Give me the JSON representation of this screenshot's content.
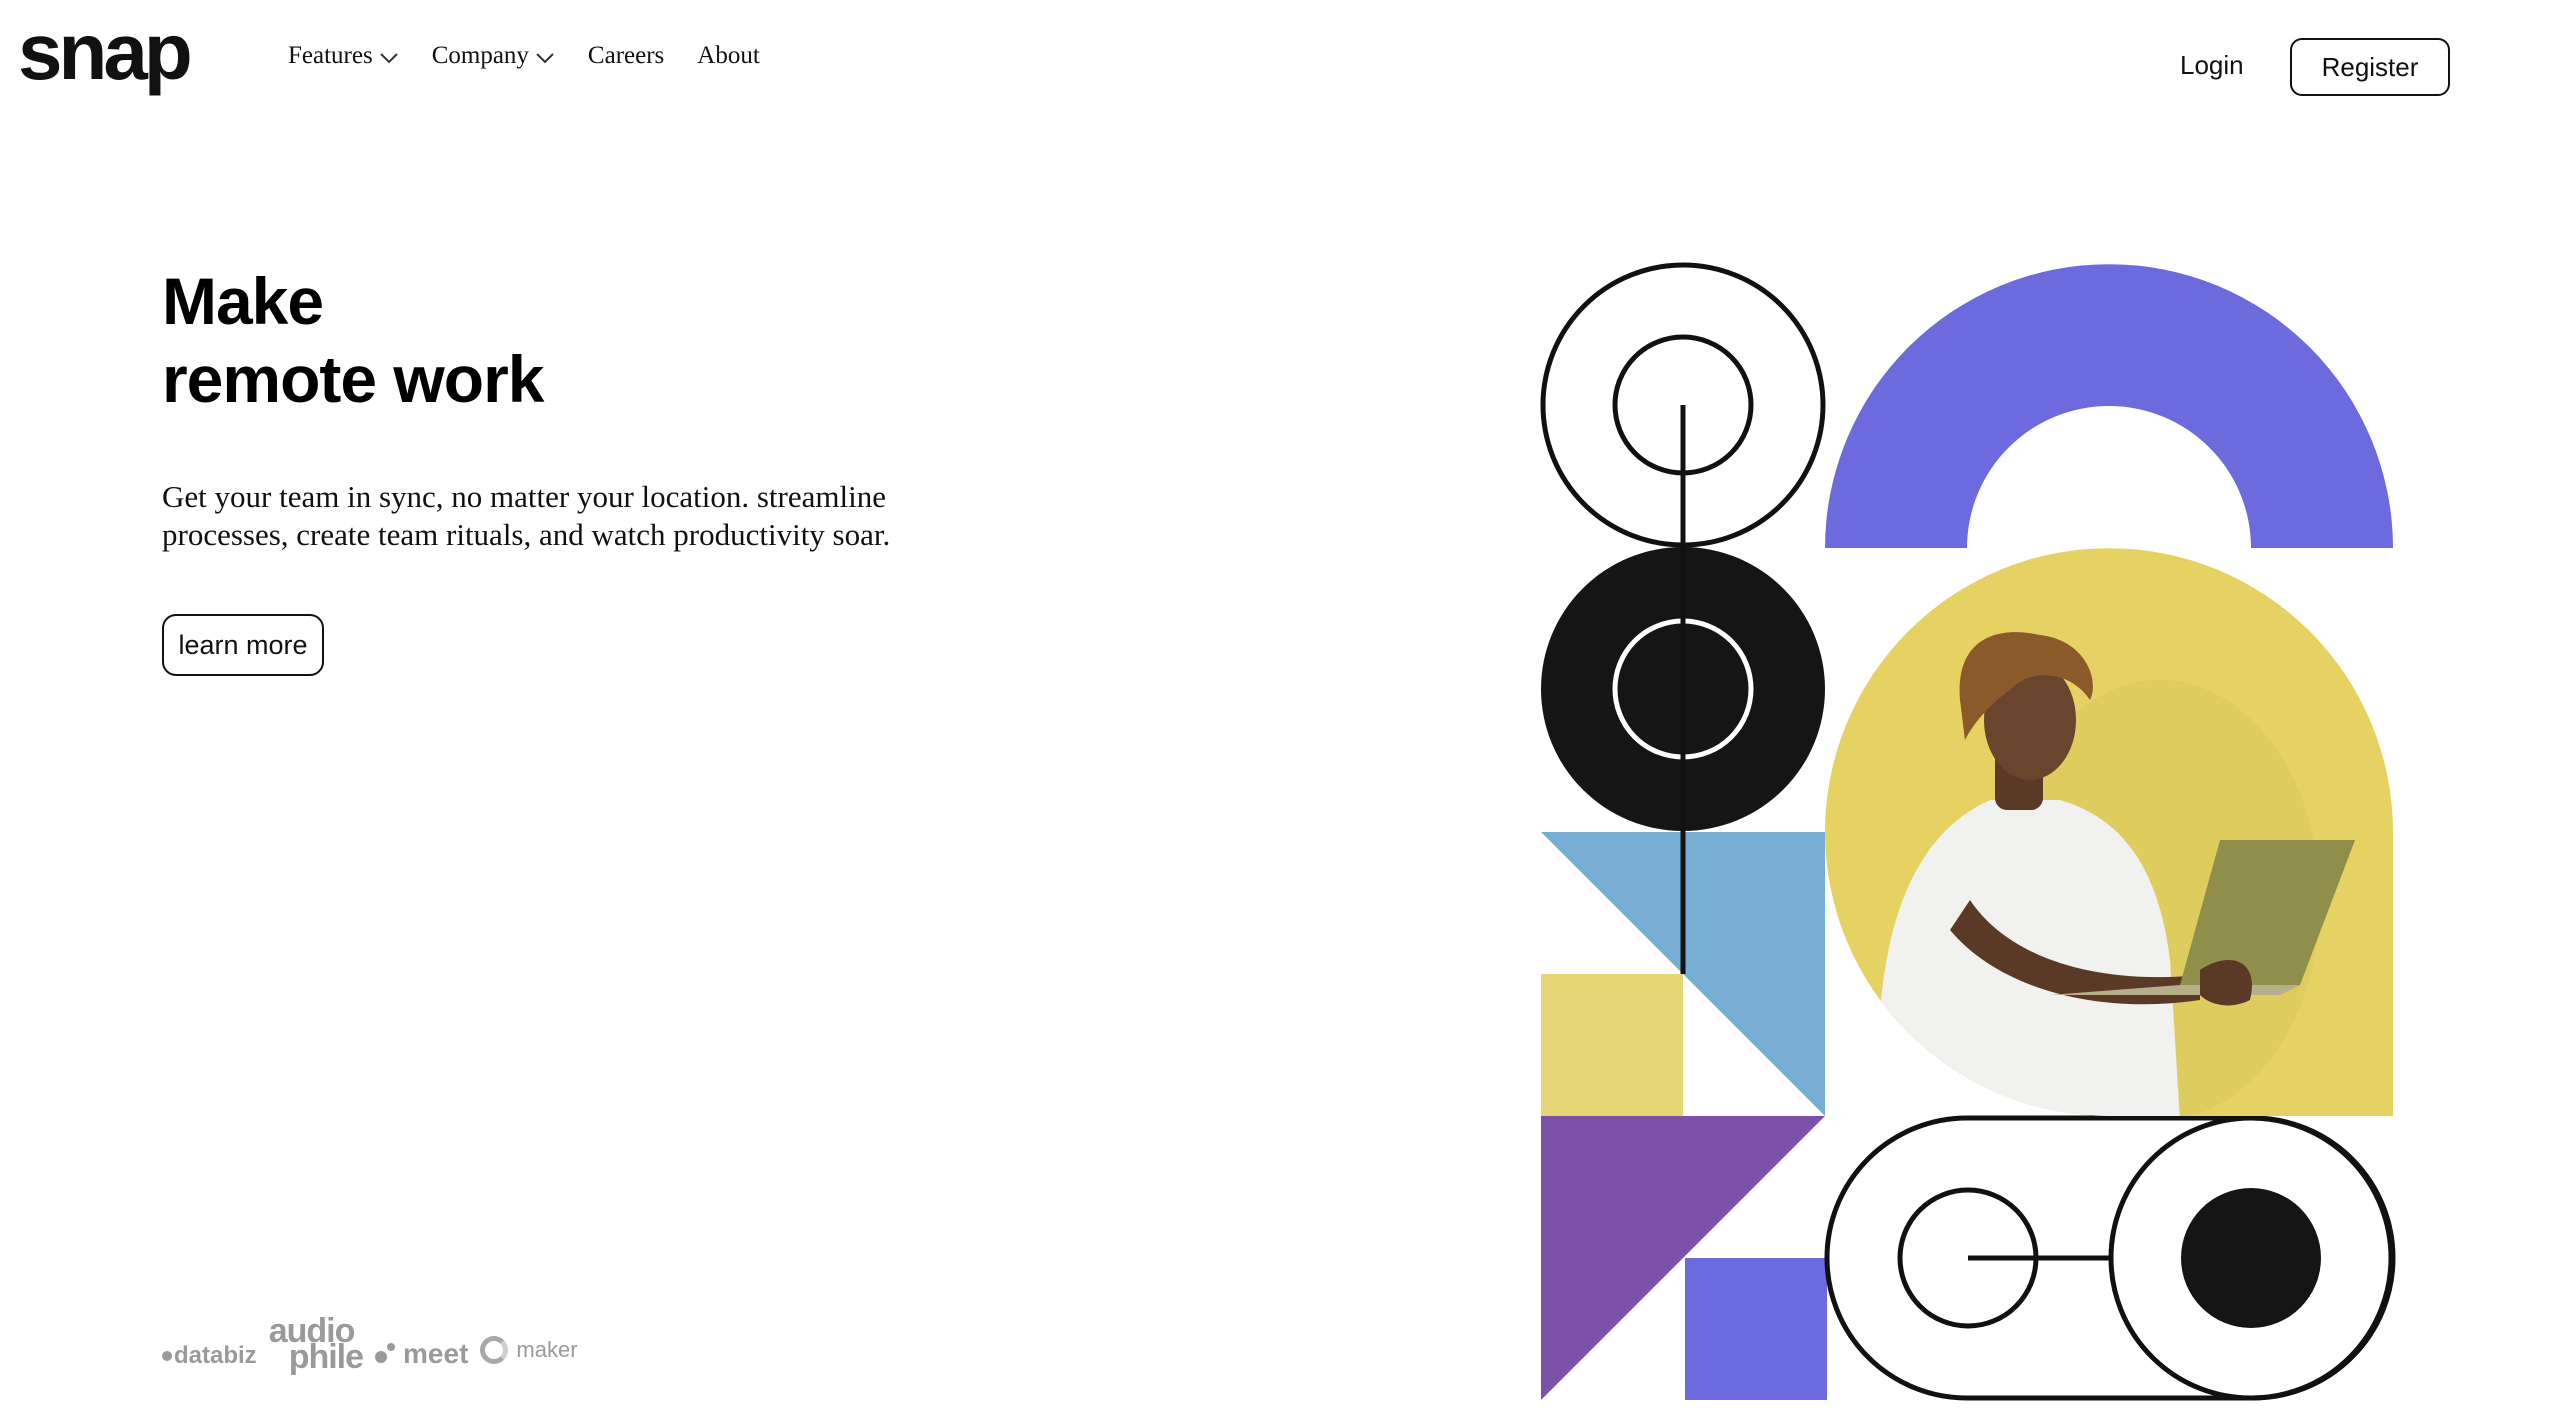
{
  "header": {
    "logo": "snap",
    "nav": [
      {
        "label": "Features",
        "dropdown": true
      },
      {
        "label": "Company",
        "dropdown": true
      },
      {
        "label": "Careers",
        "dropdown": false
      },
      {
        "label": "About",
        "dropdown": false
      }
    ],
    "login_label": "Login",
    "register_label": "Register"
  },
  "hero": {
    "title_line1": "Make",
    "title_line2": "remote work",
    "description": "Get your team in sync, no matter your location. streamline processes, create team rituals, and watch productivity soar.",
    "cta_label": "learn more"
  },
  "clients": {
    "databiz": "databiz",
    "audiophile_top": "audio",
    "audiophile_bottom": "phile",
    "meet": "meet",
    "maker": "maker"
  },
  "colors": {
    "purple": "#6D6ADE",
    "blue": "#78ADD4",
    "yellow": "#E7D676",
    "violet": "#7D50A9",
    "black": "#151515",
    "photo_background": "#E5D262"
  }
}
